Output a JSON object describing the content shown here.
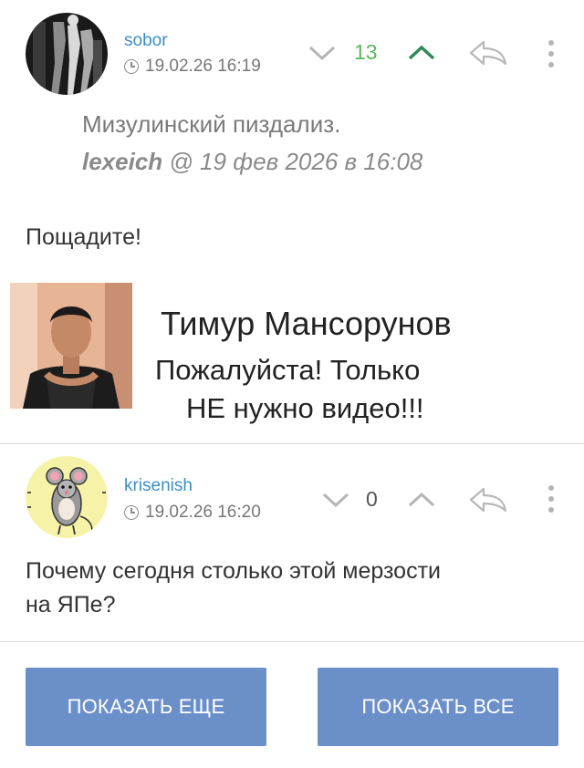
{
  "comments": [
    {
      "username": "sobor",
      "timestamp": "19.02.26 16:19",
      "score": "13",
      "score_color": "#5cb85c",
      "upvoted": true,
      "quote": {
        "text": "Мизулинский пиздализ.",
        "author": "lexeich",
        "at": "@",
        "date": "19 фев 2026 в 16:08"
      },
      "body": "Пощадите!",
      "meme": {
        "name": "Тимур Мансорунов",
        "line1": "Пожалуйста! Только",
        "line2": "НЕ нужно видео!!!"
      }
    },
    {
      "username": "krisenish",
      "timestamp": "19.02.26 16:20",
      "score": "0",
      "score_color": "#555555",
      "upvoted": false,
      "body_line1": "Почему сегодня столько этой мерзости",
      "body_line2": "на ЯПе?"
    }
  ],
  "buttons": {
    "show_more": "ПОКАЗАТЬ ЕЩЕ",
    "show_all": "ПОКАЗАТЬ ВСЕ"
  },
  "colors": {
    "accent_button": "#6b8fc9",
    "username": "#3b8fc4",
    "upvote_active": "#2e8b57"
  }
}
